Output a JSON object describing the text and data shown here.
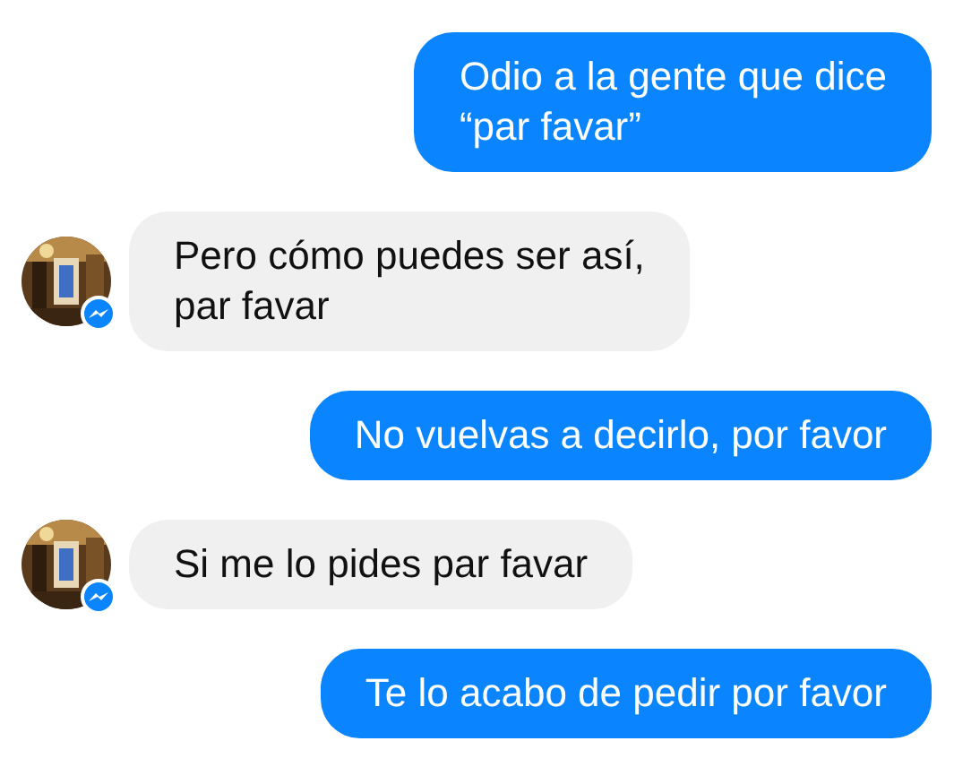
{
  "messages": [
    {
      "kind": "sent",
      "lines": [
        "Odio a la gente que dice",
        "“par favar”"
      ]
    },
    {
      "kind": "received",
      "lines": [
        "Pero cómo puedes ser así,",
        "par favar"
      ]
    },
    {
      "kind": "sent",
      "lines": [
        "No vuelvas a decirlo, por favor"
      ]
    },
    {
      "kind": "received",
      "lines": [
        "Si me lo pides par favar"
      ]
    },
    {
      "kind": "sent",
      "lines": [
        "Te lo acabo de pedir por favor"
      ]
    }
  ]
}
